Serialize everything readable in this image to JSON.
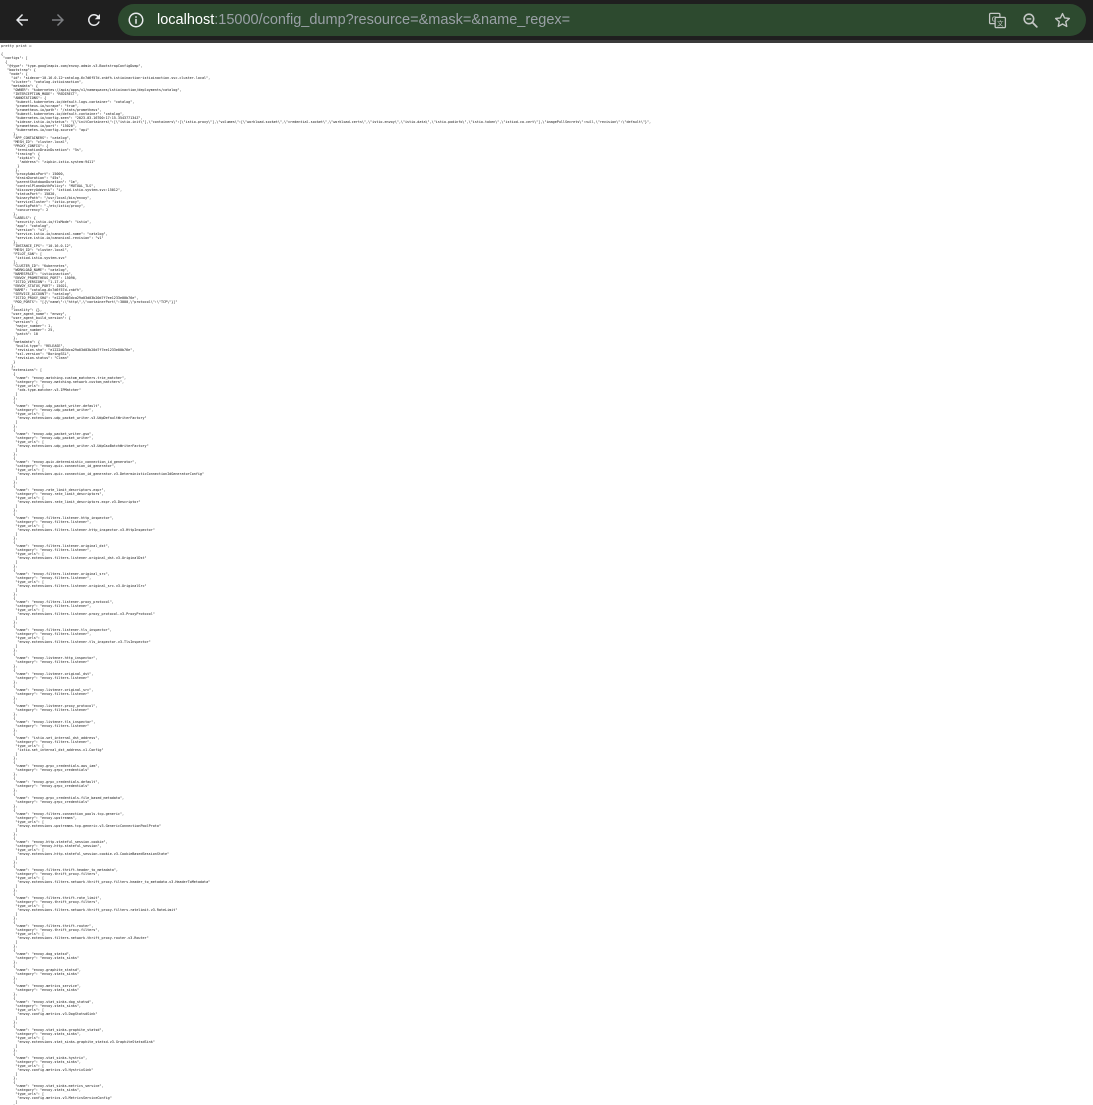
{
  "browser": {
    "url_host": "localhost",
    "url_rest": ":15000/config_dump?resource=&mask=&name_regex=",
    "toolbar_color": "#1f1f1f",
    "omnibox_color": "#2d4a2f",
    "icons": [
      "back-arrow-icon",
      "forward-arrow-icon",
      "reload-icon",
      "site-info-icon",
      "translate-icon",
      "zoom-icon",
      "bookmark-star-icon"
    ]
  },
  "page": {
    "header_line": "pretty print ☑",
    "dump_lines": [
      "{",
      " \"configs\": [",
      "  {",
      "   \"@type\": \"type.googleapis.com/envoy.admin.v3.BootstrapConfigDump\",",
      "   \"bootstrap\": {",
      "    \"node\": {",
      "     \"id\": \"sidecar~10.16.0.12~catalog-6c7d6f57d-znbfh.istioinaction~istioinaction.svc.cluster.local\",",
      "     \"cluster\": \"catalog.istioinaction\",",
      "     \"metadata\": {",
      "      \"OWNER\": \"kubernetes://apis/apps/v1/namespaces/istioinaction/deployments/catalog\",",
      "      \"INTERCEPTION_MODE\": \"REDIRECT\",",
      "      \"ANNOTATIONS\": {",
      "       \"kubectl.kubernetes.io/default-logs-container\": \"catalog\",",
      "       \"prometheus.io/scrape\": \"true\",",
      "       \"prometheus.io/path\": \"/stats/prometheus\",",
      "       \"kubectl.kubernetes.io/default-container\": \"catalog\",",
      "       \"kubernetes.io/config.seen\": \"2023-03-16T00:17:15.354377134Z\",",
      "       \"sidecar.istio.io/status\": \"{\\\"initContainers\\\":[\\\"istio-init\\\"],\\\"containers\\\":[\\\"istio-proxy\\\"],\\\"volumes\\\":[\\\"workload-socket\\\",\\\"credential-socket\\\",\\\"workload-certs\\\",\\\"istio-envoy\\\",\\\"istio-data\\\",\\\"istio-podinfo\\\",\\\"istio-token\\\",\\\"istiod-ca-cert\\\"],\\\"imagePullSecrets\\\":null,\\\"revision\\\":\\\"default\\\"}\",",
      "       \"prometheus.io/port\": \"15020\",",
      "       \"kubernetes.io/config.source\": \"api\"",
      "      },",
      "      \"APP_CONTAINERS\": \"catalog\",",
      "      \"MESH_ID\": \"cluster.local\",",
      "      \"PROXY_CONFIG\": {",
      "       \"terminationDrainDuration\": \"5s\",",
      "       \"tracing\": {",
      "        \"zipkin\": {",
      "         \"address\": \"zipkin.istio-system:9411\"",
      "        }",
      "       },",
      "       \"proxyAdminPort\": 15000,",
      "       \"drainDuration\": \"45s\",",
      "       \"parentShutdownDuration\": \"1m\",",
      "       \"controlPlaneAuthPolicy\": \"MUTUAL_TLS\",",
      "       \"discoveryAddress\": \"istiod.istio-system.svc:15012\",",
      "       \"statusPort\": 15020,",
      "       \"binaryPath\": \"/usr/local/bin/envoy\",",
      "       \"serviceCluster\": \"istio-proxy\",",
      "       \"configPath\": \"./etc/istio/proxy\",",
      "       \"concurrency\": 2",
      "      },",
      "      \"LABELS\": {",
      "       \"security.istio.io/tlsMode\": \"istio\",",
      "       \"app\": \"catalog\",",
      "       \"version\": \"v1\",",
      "       \"service.istio.io/canonical-name\": \"catalog\",",
      "       \"service.istio.io/canonical-revision\": \"v1\"",
      "      },",
      "      \"INSTANCE_IPS\": \"10.16.0.12\",",
      "      \"MESH_ID\": \"cluster.local\",",
      "      \"PILOT_SAN\": [",
      "       \"istiod.istio-system.svc\"",
      "      ],",
      "      \"CLUSTER_ID\": \"Kubernetes\",",
      "      \"WORKLOAD_NAME\": \"catalog\",",
      "      \"NAMESPACE\": \"istioinaction\",",
      "      \"ENVOY_PROMETHEUS_PORT\": 15090,",
      "      \"ISTIO_VERSION\": \"1.17.0\",",
      "      \"ENVOY_STATUS_PORT\": 15021,",
      "      \"NAME\": \"catalog-6c7d6f57d-znbfh\",",
      "      \"SERVICE_ACCOUNT\": \"catalog\",",
      "      \"ISTIO_PROXY_SHA\": \"e1222d03dca29a03d03b20d7f7ee1233e00b76e\",",
      "      \"POD_PORTS\": \"[{\\\"name\\\":\\\"http\\\",\\\"containerPort\\\":3000,\\\"protocol\\\":\\\"TCP\\\"}]\"",
      "     },",
      "     \"locality\": {},",
      "     \"user_agent_name\": \"envoy\",",
      "     \"user_agent_build_version\": {",
      "      \"version\": {",
      "       \"major_number\": 1,",
      "       \"minor_number\": 25,",
      "       \"patch\": 10",
      "      },",
      "      \"metadata\": {",
      "       \"build.type\": \"RELEASE\",",
      "       \"revision.sha\": \"e1222d03dca29a03d03b20d7f7ee1233e00b76e\",",
      "       \"ssl.version\": \"BoringSSL\",",
      "       \"revision.status\": \"Clean\"",
      "      }",
      "     },",
      "     \"extensions\": [",
      "      {",
      "       \"name\": \"envoy.matching.custom_matchers.trie_matcher\",",
      "       \"category\": \"envoy.matching.network.custom_matchers\",",
      "       \"type_urls\": [",
      "        \"xds.type.matcher.v3.IPMatcher\"",
      "       ]",
      "      },",
      "      {",
      "       \"name\": \"envoy.udp_packet_writer.default\",",
      "       \"category\": \"envoy.udp_packet_writer\",",
      "       \"type_urls\": [",
      "        \"envoy.extensions.udp_packet_writer.v3.UdpDefaultWriterFactory\"",
      "       ]",
      "      },",
      "      {",
      "       \"name\": \"envoy.udp_packet_writer.gso\",",
      "       \"category\": \"envoy.udp_packet_writer\",",
      "       \"type_urls\": [",
      "        \"envoy.extensions.udp_packet_writer.v3.UdpGsoBatchWriterFactory\"",
      "       ]",
      "      },",
      "      {",
      "       \"name\": \"envoy.quic.deterministic_connection_id_generator\",",
      "       \"category\": \"envoy.quic.connection_id_generator\",",
      "       \"type_urls\": [",
      "        \"envoy.extensions.quic.connection_id_generator.v3.DeterministicConnectionIdGeneratorConfig\"",
      "       ]",
      "      },",
      "      {",
      "       \"name\": \"envoy.rate_limit_descriptors.expr\",",
      "       \"category\": \"envoy.rate_limit_descriptors\",",
      "       \"type_urls\": [",
      "        \"envoy.extensions.rate_limit_descriptors.expr.v3.Descriptor\"",
      "       ]",
      "      },",
      "      {",
      "       \"name\": \"envoy.filters.listener.http_inspector\",",
      "       \"category\": \"envoy.filters.listener\",",
      "       \"type_urls\": [",
      "        \"envoy.extensions.filters.listener.http_inspector.v3.HttpInspector\"",
      "       ]",
      "      },",
      "      {",
      "       \"name\": \"envoy.filters.listener.original_dst\",",
      "       \"category\": \"envoy.filters.listener\",",
      "       \"type_urls\": [",
      "        \"envoy.extensions.filters.listener.original_dst.v3.OriginalDst\"",
      "       ]",
      "      },",
      "      {",
      "       \"name\": \"envoy.filters.listener.original_src\",",
      "       \"category\": \"envoy.filters.listener\",",
      "       \"type_urls\": [",
      "        \"envoy.extensions.filters.listener.original_src.v3.OriginalSrc\"",
      "       ]",
      "      },",
      "      {",
      "       \"name\": \"envoy.filters.listener.proxy_protocol\",",
      "       \"category\": \"envoy.filters.listener\",",
      "       \"type_urls\": [",
      "        \"envoy.extensions.filters.listener.proxy_protocol.v3.ProxyProtocol\"",
      "       ]",
      "      },",
      "      {",
      "       \"name\": \"envoy.filters.listener.tls_inspector\",",
      "       \"category\": \"envoy.filters.listener\",",
      "       \"type_urls\": [",
      "        \"envoy.extensions.filters.listener.tls_inspector.v3.TlsInspector\"",
      "       ]",
      "      },",
      "      {",
      "       \"name\": \"envoy.listener.http_inspector\",",
      "       \"category\": \"envoy.filters.listener\"",
      "      },",
      "      {",
      "       \"name\": \"envoy.listener.original_dst\",",
      "       \"category\": \"envoy.filters.listener\"",
      "      },",
      "      {",
      "       \"name\": \"envoy.listener.original_src\",",
      "       \"category\": \"envoy.filters.listener\"",
      "      },",
      "      {",
      "       \"name\": \"envoy.listener.proxy_protocol\",",
      "       \"category\": \"envoy.filters.listener\"",
      "      },",
      "      {",
      "       \"name\": \"envoy.listener.tls_inspector\",",
      "       \"category\": \"envoy.filters.listener\"",
      "      },",
      "      {",
      "       \"name\": \"istio.set_internal_dst_address\",",
      "       \"category\": \"envoy.filters.listener\",",
      "       \"type_urls\": [",
      "        \"istio.set_internal_dst_address.v1.Config\"",
      "       ]",
      "      },",
      "      {",
      "       \"name\": \"envoy.grpc_credentials.aws_iam\",",
      "       \"category\": \"envoy.grpc_credentials\"",
      "      },",
      "      {",
      "       \"name\": \"envoy.grpc_credentials.default\",",
      "       \"category\": \"envoy.grpc_credentials\"",
      "      },",
      "      {",
      "       \"name\": \"envoy.grpc_credentials.file_based_metadata\",",
      "       \"category\": \"envoy.grpc_credentials\"",
      "      },",
      "      {",
      "       \"name\": \"envoy.filters.connection_pools.tcp.generic\",",
      "       \"category\": \"envoy.upstreams\",",
      "       \"type_urls\": [",
      "        \"envoy.extensions.upstreams.tcp.generic.v3.GenericConnectionPoolProto\"",
      "       ]",
      "      },",
      "      {",
      "       \"name\": \"envoy.http.stateful_session.cookie\",",
      "       \"category\": \"envoy.http.stateful_session\",",
      "       \"type_urls\": [",
      "        \"envoy.extensions.http.stateful_session.cookie.v3.CookieBasedSessionState\"",
      "       ]",
      "      },",
      "      {",
      "       \"name\": \"envoy.filters.thrift.header_to_metadata\",",
      "       \"category\": \"envoy.thrift_proxy.filters\",",
      "       \"type_urls\": [",
      "        \"envoy.extensions.filters.network.thrift_proxy.filters.header_to_metadata.v3.HeaderToMetadata\"",
      "       ]",
      "      },",
      "      {",
      "       \"name\": \"envoy.filters.thrift.rate_limit\",",
      "       \"category\": \"envoy.thrift_proxy.filters\",",
      "       \"type_urls\": [",
      "        \"envoy.extensions.filters.network.thrift_proxy.filters.ratelimit.v3.RateLimit\"",
      "       ]",
      "      },",
      "      {",
      "       \"name\": \"envoy.filters.thrift.router\",",
      "       \"category\": \"envoy.thrift_proxy.filters\",",
      "       \"type_urls\": [",
      "        \"envoy.extensions.filters.network.thrift_proxy.router.v3.Router\"",
      "       ]",
      "      },",
      "      {",
      "       \"name\": \"envoy.dog_statsd\",",
      "       \"category\": \"envoy.stats_sinks\"",
      "      },",
      "      {",
      "       \"name\": \"envoy.graphite_statsd\",",
      "       \"category\": \"envoy.stats_sinks\"",
      "      },",
      "      {",
      "       \"name\": \"envoy.metrics_service\",",
      "       \"category\": \"envoy.stats_sinks\"",
      "      },",
      "      {",
      "       \"name\": \"envoy.stat_sinks.dog_statsd\",",
      "       \"category\": \"envoy.stats_sinks\",",
      "       \"type_urls\": [",
      "        \"envoy.config.metrics.v3.DogStatsdSink\"",
      "       ]",
      "      },",
      "      {",
      "       \"name\": \"envoy.stat_sinks.graphite_statsd\",",
      "       \"category\": \"envoy.stats_sinks\",",
      "       \"type_urls\": [",
      "        \"envoy.extensions.stat_sinks.graphite_statsd.v3.GraphiteStatsdSink\"",
      "       ]",
      "      },",
      "      {",
      "       \"name\": \"envoy.stat_sinks.hystrix\",",
      "       \"category\": \"envoy.stats_sinks\",",
      "       \"type_urls\": [",
      "        \"envoy.config.metrics.v3.HystrixSink\"",
      "       ]",
      "      },",
      "      {",
      "       \"name\": \"envoy.stat_sinks.metrics_service\",",
      "       \"category\": \"envoy.stats_sinks\",",
      "       \"type_urls\": [",
      "        \"envoy.config.metrics.v3.MetricsServiceConfig\"",
      "       ]",
      "      },"
    ]
  }
}
